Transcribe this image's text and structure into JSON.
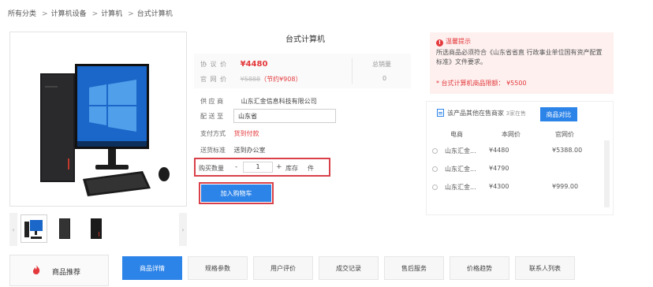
{
  "breadcrumb": [
    "所有分类",
    "计算机设备",
    "计算机",
    "台式计算机"
  ],
  "breadcrumb_sep": ">",
  "product": {
    "title": "台式计算机",
    "agreement_price_label": "协 议 价",
    "agreement_price": "¥4480",
    "market_price_label": "官 网 价",
    "market_price": "¥5888",
    "saving": "（节约¥908）",
    "sales_label": "总销量",
    "sales_value": "0",
    "supplier_label": "供 应 商",
    "supplier_value": "山东汇金信息科技有限公司",
    "delivery_label": "配 送 至",
    "delivery_value": "山东省",
    "payment_label": "支付方式",
    "payment_value": "货到付款",
    "delivery_std_label": "送货标准",
    "delivery_std_value": "送到办公室",
    "qty_label": "购买数量",
    "qty_minus": "-",
    "qty_value": "1",
    "qty_plus": "+",
    "stock_label": "库存",
    "stock_unit": "件",
    "add_cart": "加入购物车"
  },
  "notice": {
    "title": "温馨提示",
    "text": "所选商品必须符合《山东省省直 行政事业单位国有资产配置标准》文件要求。",
    "limit": "* 台式计算机商品限额： ¥5500"
  },
  "others": {
    "title": "该产品其他在售商家",
    "count": "3家在售",
    "compare_btn": "商品对比",
    "headers": [
      "电商",
      "本网价",
      "官网价"
    ],
    "rows": [
      {
        "seller": "山东汇金...",
        "price": "¥4480",
        "official": "¥5388.00"
      },
      {
        "seller": "山东汇金...",
        "price": "¥4790",
        "official": ""
      },
      {
        "seller": "山东汇金...",
        "price": "¥4300",
        "official": "¥999.00"
      }
    ]
  },
  "tabs": {
    "recommend": "商品推荐",
    "items": [
      "商品详情",
      "规格参数",
      "用户评价",
      "成交记录",
      "售后服务",
      "价格趋势",
      "联系人列表"
    ]
  },
  "colors": {
    "accent": "#2d84e8",
    "price_red": "#e4393c",
    "notice_bg": "#fdf0ef"
  },
  "icons": [
    "fire-icon",
    "info-circle-icon",
    "document-icon",
    "chevron-left-icon",
    "chevron-right-icon"
  ]
}
